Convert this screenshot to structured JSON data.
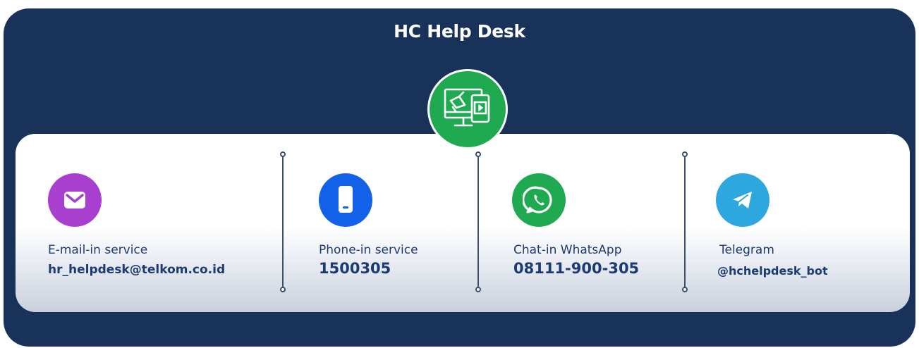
{
  "title": "HC Help Desk",
  "colors": {
    "background": "#18325a",
    "hub": "#1faa52",
    "text": "#1c3a74",
    "email": "#a93fcf",
    "phone": "#1261e8",
    "whatsapp": "#1faa52",
    "telegram": "#2ea6de"
  },
  "hub_icon": "digital-media-icon",
  "channels": [
    {
      "icon": "email-icon",
      "label": "E-mail-in service",
      "value": "hr_helpdesk@telkom.co.id"
    },
    {
      "icon": "phone-icon",
      "label": "Phone-in service",
      "value": "1500305"
    },
    {
      "icon": "whatsapp-icon",
      "label": "Chat-in WhatsApp",
      "value": "08111-900-305"
    },
    {
      "icon": "telegram-icon",
      "label": "Telegram",
      "value": "@hchelpdesk_bot"
    }
  ]
}
